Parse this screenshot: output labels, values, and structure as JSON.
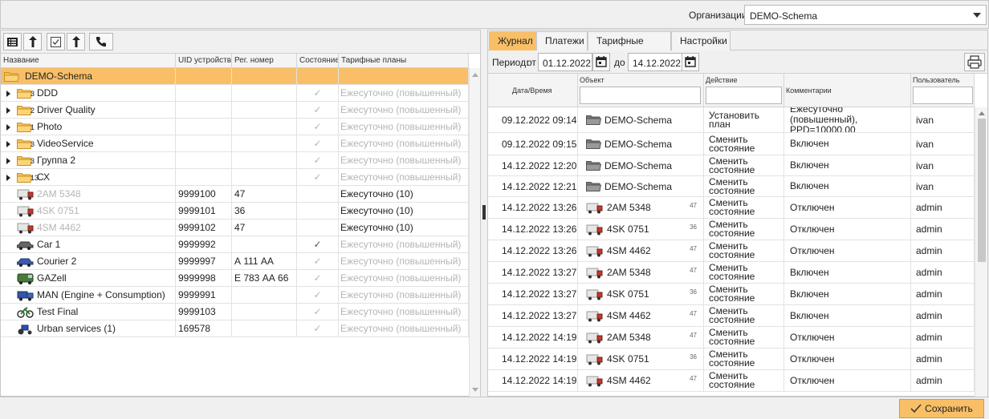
{
  "header": {
    "org_label": "Организации",
    "org_value": "DEMO-Schema"
  },
  "toolbar": {
    "icons": [
      "list-icon",
      "sort-up-icon",
      "checkbox-icon",
      "sort-up-icon",
      "phone-icon"
    ]
  },
  "tree": {
    "columns": [
      "Название",
      "UID устройства",
      "Рег. номер",
      "Состояние",
      "Тарифные планы"
    ],
    "rows": [
      {
        "name": "DEMO-Schema",
        "type": "folder",
        "selected": true,
        "expander": false,
        "count": "",
        "uid": "",
        "reg": "",
        "state": "",
        "plan": "",
        "plan_gray": false,
        "name_gray": false
      },
      {
        "name": "DDD",
        "type": "folder",
        "expander": true,
        "count": "3",
        "uid": "",
        "reg": "",
        "state": "✓",
        "plan": "Ежесуточно (повышенный)",
        "plan_gray": true,
        "name_gray": false
      },
      {
        "name": "Driver Quality",
        "type": "folder",
        "expander": true,
        "count": "2",
        "uid": "",
        "reg": "",
        "state": "✓",
        "plan": "Ежесуточно (повышенный)",
        "plan_gray": true,
        "name_gray": false
      },
      {
        "name": "Photo",
        "type": "folder",
        "expander": true,
        "count": "1",
        "uid": "",
        "reg": "",
        "state": "✓",
        "plan": "Ежесуточно (повышенный)",
        "plan_gray": true,
        "name_gray": false
      },
      {
        "name": "VideoService",
        "type": "folder",
        "expander": true,
        "count": "3",
        "uid": "",
        "reg": "",
        "state": "✓",
        "plan": "Ежесуточно (повышенный)",
        "plan_gray": true,
        "name_gray": false
      },
      {
        "name": "Группа 2",
        "type": "folder",
        "expander": true,
        "count": "3",
        "uid": "",
        "reg": "",
        "state": "✓",
        "plan": "Ежесуточно (повышенный)",
        "plan_gray": true,
        "name_gray": false
      },
      {
        "name": "СХ",
        "type": "folder",
        "expander": true,
        "count": "13",
        "uid": "",
        "reg": "",
        "state": "✓",
        "plan": "Ежесуточно (повышенный)",
        "plan_gray": true,
        "name_gray": false
      },
      {
        "name": "2AM 5348",
        "type": "truck",
        "expander": false,
        "count": "",
        "uid": "9999100",
        "reg": "47",
        "state": "",
        "plan": "Ежесуточно (10)",
        "plan_gray": false,
        "name_gray": true
      },
      {
        "name": "4SK 0751",
        "type": "truck",
        "expander": false,
        "count": "",
        "uid": "9999101",
        "reg": "36",
        "state": "",
        "plan": "Ежесуточно (10)",
        "plan_gray": false,
        "name_gray": true
      },
      {
        "name": "4SM 4462",
        "type": "truck",
        "expander": false,
        "count": "",
        "uid": "9999102",
        "reg": "47",
        "state": "",
        "plan": "Ежесуточно (10)",
        "plan_gray": false,
        "name_gray": true
      },
      {
        "name": "Car 1",
        "type": "car",
        "expander": false,
        "count": "",
        "uid": "9999992",
        "reg": "",
        "state": "✓",
        "plan": "Ежесуточно (повышенный)",
        "plan_gray": true,
        "name_gray": false,
        "state_dark": true
      },
      {
        "name": "Courier 2",
        "type": "carblue",
        "expander": false,
        "count": "",
        "uid": "9999997",
        "reg": "А 111 АА",
        "state": "✓",
        "plan": "Ежесуточно (повышенный)",
        "plan_gray": true,
        "name_gray": false
      },
      {
        "name": "GAZell",
        "type": "van",
        "expander": false,
        "count": "",
        "uid": "9999998",
        "reg": "Е 783 АА 66",
        "state": "✓",
        "plan": "Ежесуточно (повышенный)",
        "plan_gray": true,
        "name_gray": false
      },
      {
        "name": "MAN (Engine + Consumption)",
        "type": "truckblue",
        "expander": false,
        "count": "",
        "uid": "9999991",
        "reg": "",
        "state": "✓",
        "plan": "Ежесуточно (повышенный)",
        "plan_gray": true,
        "name_gray": false
      },
      {
        "name": "Test Final",
        "type": "bike",
        "expander": false,
        "count": "",
        "uid": "9999103",
        "reg": "",
        "state": "✓",
        "plan": "Ежесуточно (повышенный)",
        "plan_gray": true,
        "name_gray": false
      },
      {
        "name": "Urban services (1)",
        "type": "tractor",
        "expander": false,
        "count": "",
        "uid": "169578",
        "reg": "",
        "state": "✓",
        "plan": "Ежесуточно (повышенный)",
        "plan_gray": true,
        "name_gray": false
      }
    ]
  },
  "tabs": [
    "Журнал",
    "Платежи",
    "Тарифные планы",
    "Настройки"
  ],
  "period": {
    "label": "Период:",
    "from_label": "от",
    "from": "01.12.2022",
    "to_label": "до",
    "to": "14.12.2022"
  },
  "journal": {
    "columns": [
      "Дата/Время",
      "Объект",
      "Действие",
      "Комментарии",
      "Пользователь"
    ],
    "rows": [
      {
        "dt": "09.12.2022 09:14",
        "obj": "DEMO-Schema",
        "obj_type": "folder",
        "num": "",
        "action": "Установить план",
        "comment": "Ежесуточно (повышенный), PPD=10000.00",
        "user": "ivan",
        "h": 32
      },
      {
        "dt": "09.12.2022 09:15",
        "obj": "DEMO-Schema",
        "obj_type": "folder",
        "num": "",
        "action": "Сменить состояние",
        "comment": "Включен",
        "user": "ivan",
        "h": 28
      },
      {
        "dt": "14.12.2022 12:20",
        "obj": "DEMO-Schema",
        "obj_type": "folder",
        "num": "",
        "action": "Сменить состояние",
        "comment": "Включен",
        "user": "ivan",
        "h": 26
      },
      {
        "dt": "14.12.2022 12:21",
        "obj": "DEMO-Schema",
        "obj_type": "folder",
        "num": "",
        "action": "Сменить состояние",
        "comment": "Включен",
        "user": "ivan",
        "h": 26
      },
      {
        "dt": "14.12.2022 13:26",
        "obj": "2AM 5348",
        "obj_type": "truck",
        "num": "47",
        "action": "Сменить состояние",
        "comment": "Отключен",
        "user": "admin",
        "h": 27
      },
      {
        "dt": "14.12.2022 13:26",
        "obj": "4SK 0751",
        "obj_type": "truck",
        "num": "36",
        "action": "Сменить состояние",
        "comment": "Отключен",
        "user": "admin",
        "h": 27
      },
      {
        "dt": "14.12.2022 13:26",
        "obj": "4SM 4462",
        "obj_type": "truck",
        "num": "47",
        "action": "Сменить состояние",
        "comment": "Отключен",
        "user": "admin",
        "h": 27
      },
      {
        "dt": "14.12.2022 13:27",
        "obj": "2AM 5348",
        "obj_type": "truck",
        "num": "47",
        "action": "Сменить состояние",
        "comment": "Включен",
        "user": "admin",
        "h": 27
      },
      {
        "dt": "14.12.2022 13:27",
        "obj": "4SK 0751",
        "obj_type": "truck",
        "num": "36",
        "action": "Сменить состояние",
        "comment": "Включен",
        "user": "admin",
        "h": 27
      },
      {
        "dt": "14.12.2022 13:27",
        "obj": "4SM 4462",
        "obj_type": "truck",
        "num": "47",
        "action": "Сменить состояние",
        "comment": "Включен",
        "user": "admin",
        "h": 27
      },
      {
        "dt": "14.12.2022 14:19",
        "obj": "2AM 5348",
        "obj_type": "truck",
        "num": "47",
        "action": "Сменить состояние",
        "comment": "Отключен",
        "user": "admin",
        "h": 27
      },
      {
        "dt": "14.12.2022 14:19",
        "obj": "4SK 0751",
        "obj_type": "truck",
        "num": "36",
        "action": "Сменить состояние",
        "comment": "Отключен",
        "user": "admin",
        "h": 27
      },
      {
        "dt": "14.12.2022 14:19",
        "obj": "4SM 4462",
        "obj_type": "truck",
        "num": "47",
        "action": "Сменить состояние",
        "comment": "Отключен",
        "user": "admin",
        "h": 27
      }
    ]
  },
  "footer": {
    "save_label": "Сохранить"
  },
  "colors": {
    "accent": "#f9bf66",
    "gray_text": "#b5b5b5"
  }
}
